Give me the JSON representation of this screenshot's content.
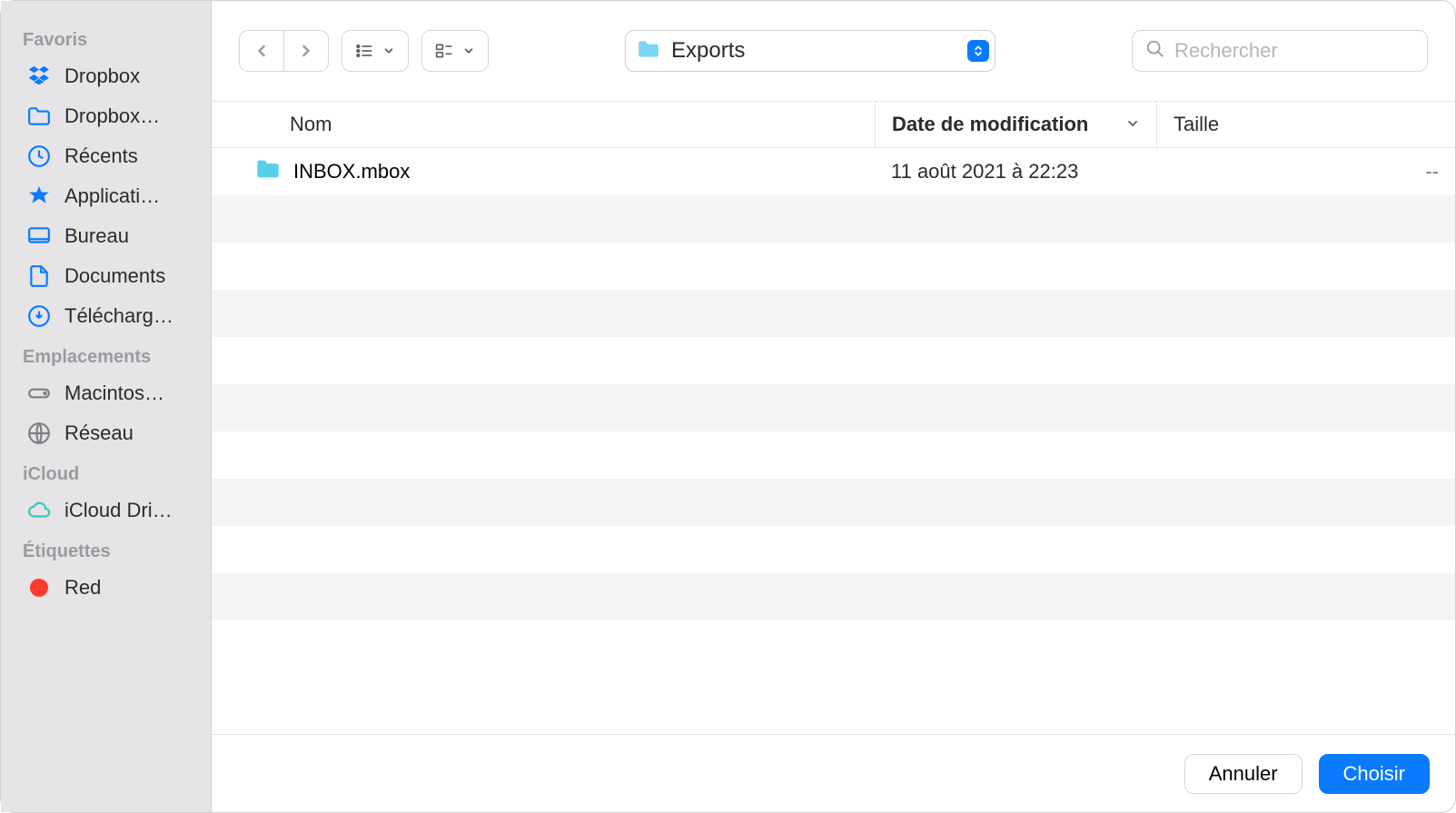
{
  "sidebar": {
    "sections": {
      "favorites": {
        "header": "Favoris",
        "items": [
          "Dropbox",
          "Dropbox…",
          "Récents",
          "Applicati…",
          "Bureau",
          "Documents",
          "Télécharg…"
        ]
      },
      "locations": {
        "header": "Emplacements",
        "items": [
          "Macintos…",
          "Réseau"
        ]
      },
      "icloud": {
        "header": "iCloud",
        "items": [
          "iCloud Dri…"
        ]
      },
      "tags": {
        "header": "Étiquettes",
        "items": [
          {
            "label": "Red",
            "color": "#ff3b30"
          }
        ]
      }
    }
  },
  "toolbar": {
    "location_label": "Exports",
    "search_placeholder": "Rechercher"
  },
  "columns": {
    "name": "Nom",
    "modified": "Date de modification",
    "size": "Taille"
  },
  "rows": [
    {
      "name": "INBOX.mbox",
      "modified": "11 août 2021 à 22:23",
      "size": "--"
    }
  ],
  "footer": {
    "cancel": "Annuler",
    "choose": "Choisir"
  }
}
